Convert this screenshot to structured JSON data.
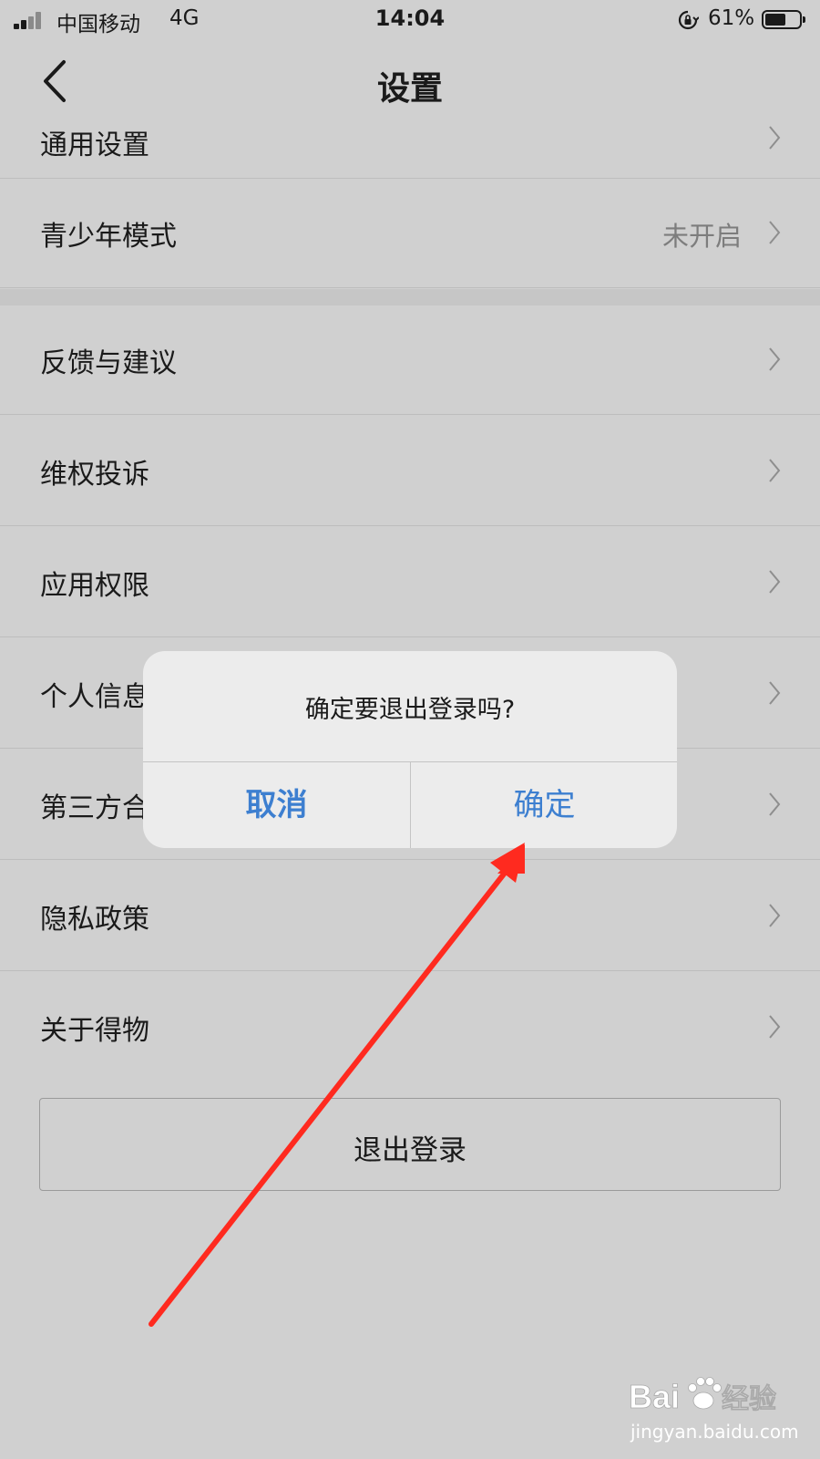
{
  "status_bar": {
    "carrier": "中国移动",
    "network": "4G",
    "time": "14:04",
    "battery": "61%",
    "battery_level": 0.61,
    "icons": [
      "signal-icon",
      "rotation-lock-icon",
      "battery-icon"
    ]
  },
  "header": {
    "title": "设置",
    "back_icon": "chevron-left-icon"
  },
  "settings": {
    "partial_item": "通用设置",
    "items": [
      {
        "label": "青少年模式",
        "value": "未开启"
      },
      {
        "label": "反馈与建议"
      },
      {
        "label": "维权投诉"
      },
      {
        "label": "应用权限"
      },
      {
        "label": "个人信息"
      },
      {
        "label": "第三方合"
      },
      {
        "label": "隐私政策"
      },
      {
        "label": "关于得物"
      }
    ],
    "logout": "退出登录"
  },
  "dialog": {
    "message": "确定要退出登录吗?",
    "cancel": "取消",
    "confirm": "确定"
  },
  "annotation": {
    "color": "#ff2a1f"
  },
  "watermark": {
    "brand": "Bai 经验",
    "url": "jingyan.baidu.com"
  },
  "colors": {
    "accent": "#3d7fd0",
    "background": "#d0d0d0",
    "secondary_text": "#7d7d7d"
  }
}
